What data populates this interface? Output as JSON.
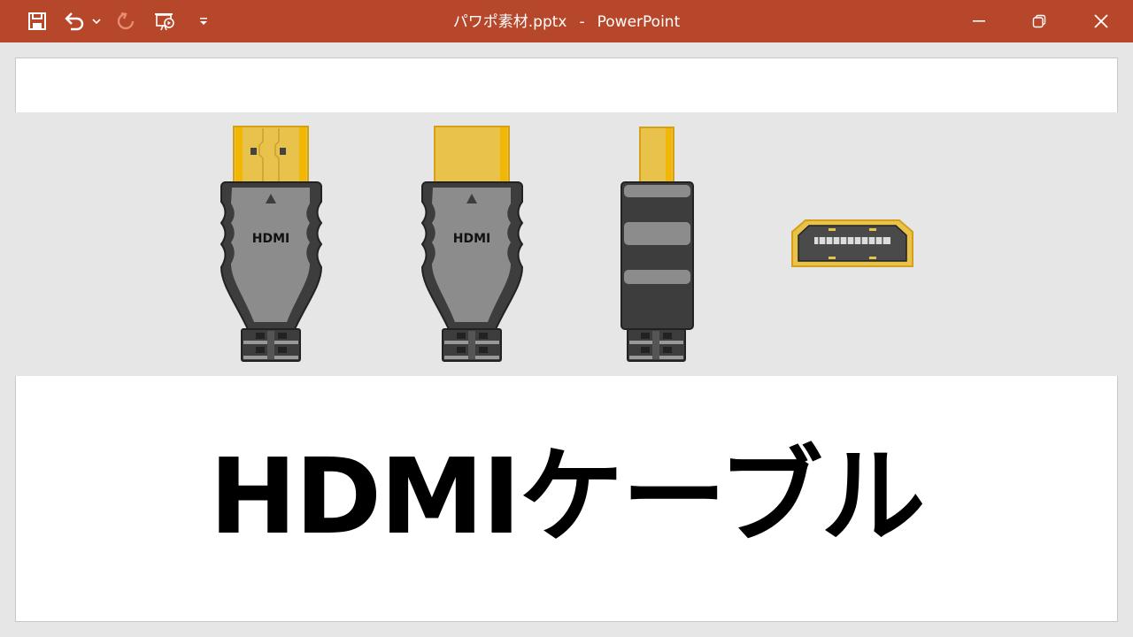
{
  "window": {
    "file_name": "パワポ素材.pptx",
    "separator": "-",
    "app_name": "PowerPoint"
  },
  "quick_access": {
    "icons": [
      "save-icon",
      "undo-icon",
      "chevron-down-icon",
      "redo-icon",
      "slideshow-from-beginning-icon",
      "customize-toolbar-icon"
    ]
  },
  "window_controls": {
    "icons": [
      "minimize-icon",
      "restore-icon",
      "close-icon"
    ]
  },
  "slide": {
    "title": "HDMIケーブル",
    "logo_text": "HDMI",
    "band_color": "#e6e6e6"
  },
  "colors": {
    "titlebar": "#b7472a",
    "connector_gold": "#e8c24a",
    "connector_gold_edge": "#d4a017",
    "housing_gray": "#8c8c8c",
    "housing_dark": "#3d3d3d"
  }
}
